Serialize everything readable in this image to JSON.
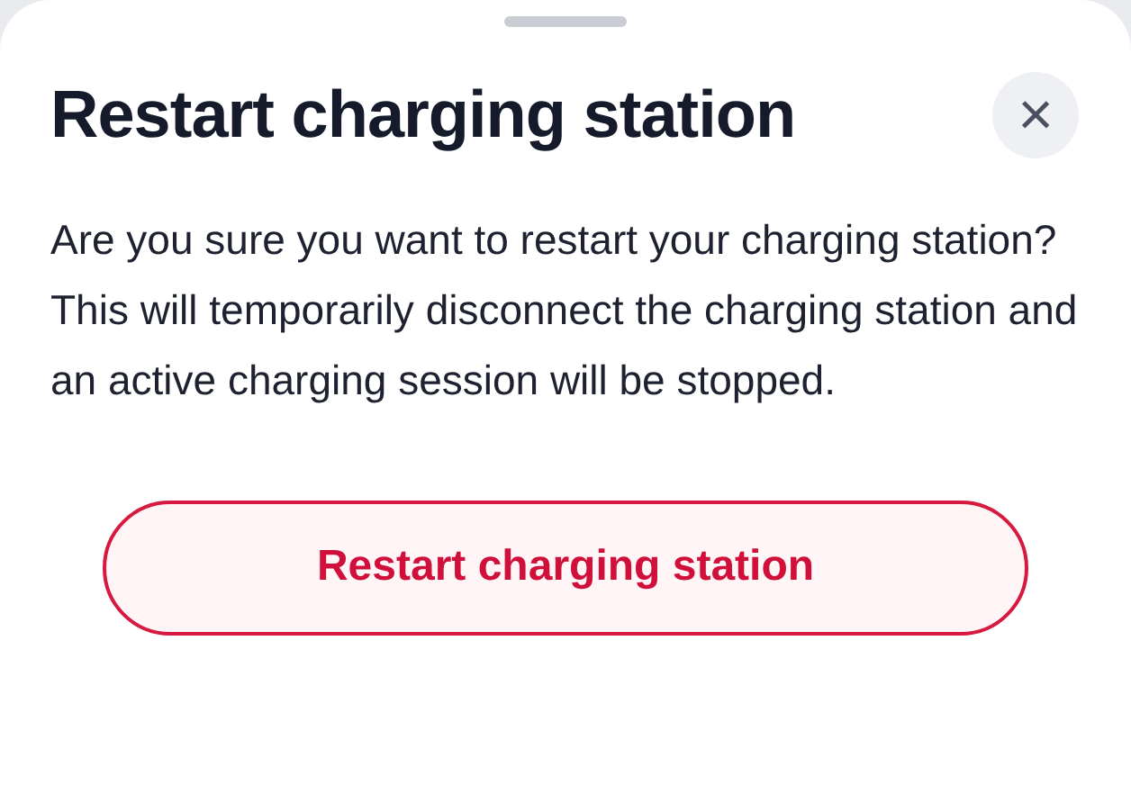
{
  "sheet": {
    "title": "Restart charging station",
    "message": "Are you sure you want to restart your charging station? This will temporarily disconnect the charging station and an active charging session will be stopped.",
    "close_label": "×",
    "buttons": [
      {
        "label": "Restart charging station",
        "kind": "danger"
      }
    ]
  }
}
